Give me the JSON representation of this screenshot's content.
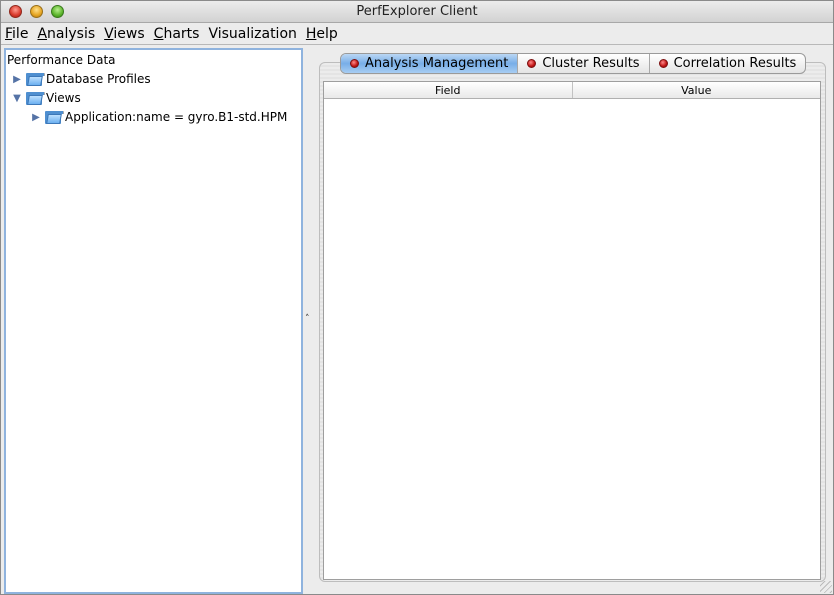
{
  "window": {
    "title": "PerfExplorer Client"
  },
  "menubar": {
    "items": [
      {
        "label": "File",
        "mnemonic": "F",
        "rest": "ile"
      },
      {
        "label": "Analysis",
        "mnemonic": "A",
        "rest": "nalysis"
      },
      {
        "label": "Views",
        "mnemonic": "V",
        "rest": "iews"
      },
      {
        "label": "Charts",
        "mnemonic": "C",
        "rest": "harts"
      },
      {
        "label": "Visualization",
        "mnemonic": "",
        "rest": "Visualization"
      },
      {
        "label": "Help",
        "mnemonic": "H",
        "rest": "elp"
      }
    ]
  },
  "tree": {
    "root": "Performance Data",
    "items": [
      {
        "label": "Database Profiles",
        "expanded": false,
        "icon": "folder-icon"
      },
      {
        "label": "Views",
        "expanded": true,
        "icon": "folder-open-icon"
      },
      {
        "label": "Application:name = gyro.B1-std.HPM",
        "expanded": false,
        "icon": "folder-icon"
      }
    ]
  },
  "tabs": [
    {
      "label": "Analysis Management",
      "active": true
    },
    {
      "label": "Cluster Results",
      "active": false
    },
    {
      "label": "Correlation Results",
      "active": false
    }
  ],
  "table": {
    "columns": [
      "Field",
      "Value"
    ]
  },
  "colors": {
    "active_tab": "#78aee8",
    "tab_dot": "#c01515",
    "tree_border": "#8fb3de"
  }
}
